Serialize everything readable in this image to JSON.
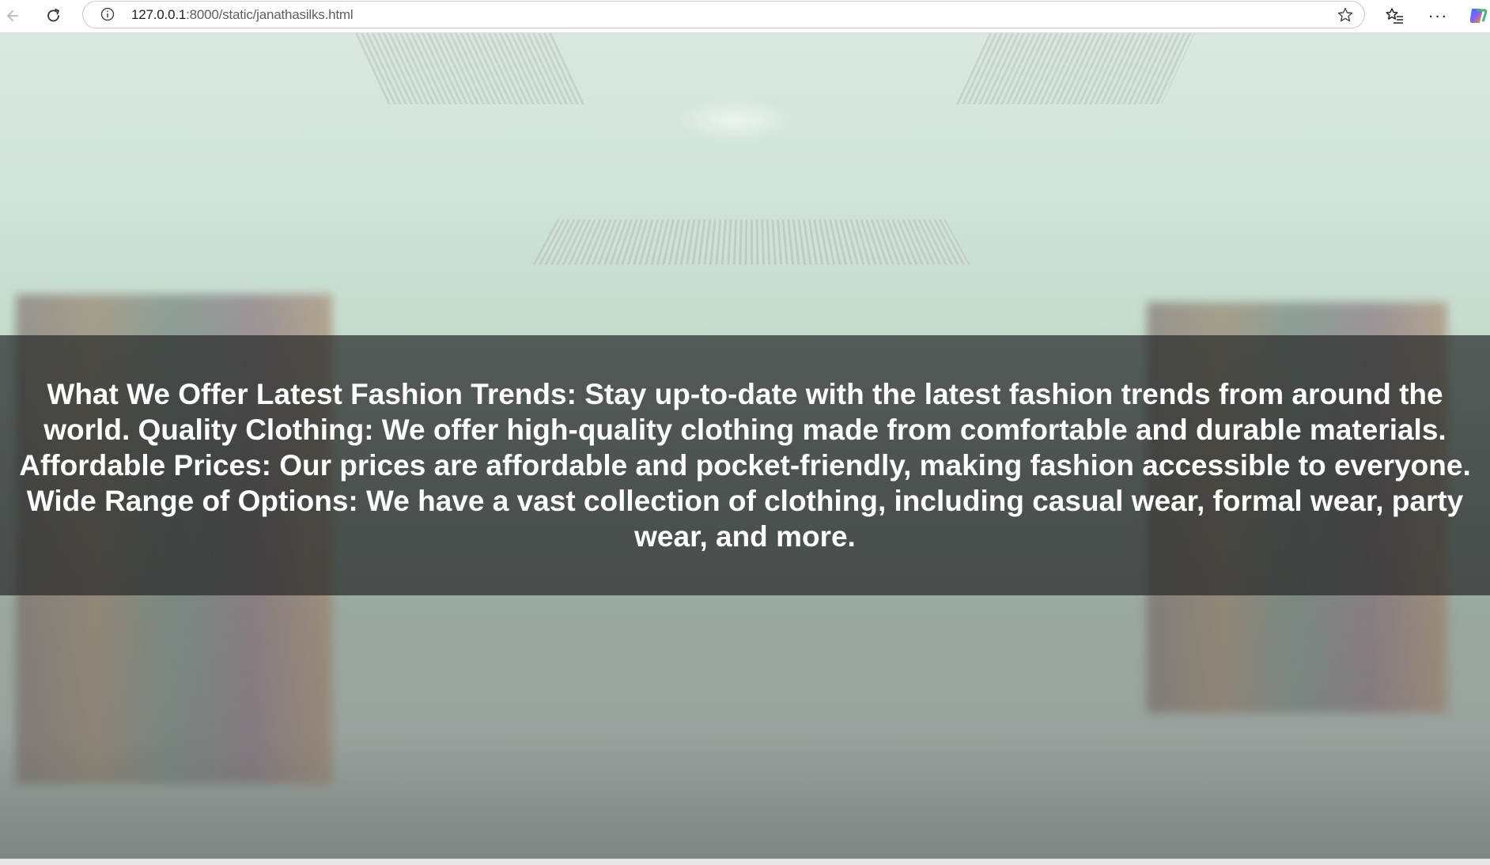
{
  "browser": {
    "url_host": "127.0.0.1",
    "url_path": ":8000/static/janathasilks.html",
    "icons": {
      "back": "back-arrow-icon",
      "reload": "reload-icon",
      "info": "info-icon",
      "favorite": "star-icon",
      "favorites": "favorites-list-icon",
      "more": "more-icon",
      "copilot": "copilot-icon"
    },
    "more_label": "···"
  },
  "hero": {
    "offer_text": "What We Offer Latest Fashion Trends: Stay up-to-date with the latest fashion trends from around the world. Quality Clothing: We offer high-quality clothing made from comfortable and durable materials. Affordable Prices: Our prices are affordable and pocket-friendly, making fashion accessible to everyone. Wide Range of Options: We have a vast collection of clothing, including casual wear, formal wear, party wear, and more."
  },
  "colors": {
    "overlay": "#2a2c2b",
    "text": "#ffffff",
    "background_tint": "#c6dccf"
  }
}
